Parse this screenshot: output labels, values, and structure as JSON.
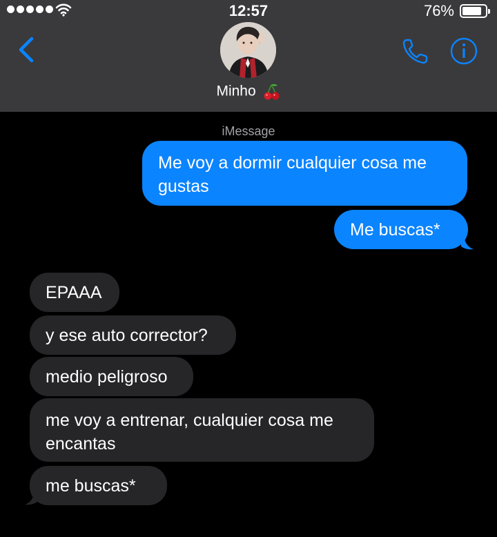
{
  "status_bar": {
    "time": "12:57",
    "battery_percent": "76%",
    "battery_level": 0.76,
    "signal_bars": 5
  },
  "header": {
    "contact_name": "Minho",
    "contact_emoji": "cherries",
    "back_icon": "chevron-left-icon",
    "call_icon": "phone-icon",
    "info_icon": "info-icon"
  },
  "conversation": {
    "service_label": "iMessage",
    "messages": [
      {
        "sender": "me",
        "text": "Me voy a dormir cualquier cosa me gustas"
      },
      {
        "sender": "me",
        "text": "Me buscas*"
      },
      {
        "sender": "contact",
        "text": "EPAAA"
      },
      {
        "sender": "contact",
        "text": "y ese auto corrector?"
      },
      {
        "sender": "contact",
        "text": "medio peligroso"
      },
      {
        "sender": "contact",
        "text": "me voy a entrenar, cualquier cosa me encantas"
      },
      {
        "sender": "contact",
        "text": "me buscas*"
      }
    ]
  },
  "colors": {
    "header_bg": "#3a3a3c",
    "accent_blue": "#0b84ff",
    "sent_bubble": "#0b84ff",
    "received_bubble": "#262629",
    "background": "#000000"
  }
}
